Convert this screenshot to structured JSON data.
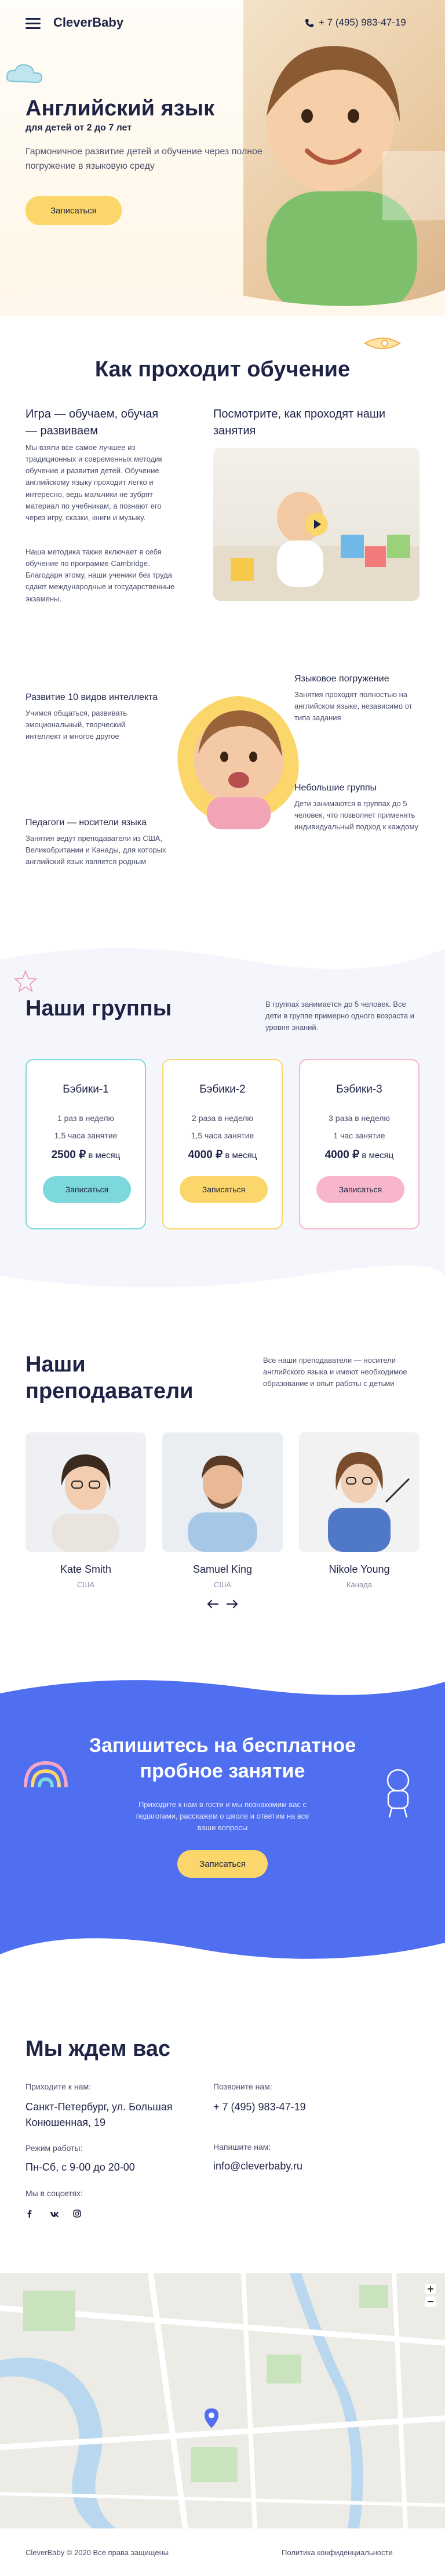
{
  "header": {
    "logo": "CleverBaby",
    "phone": "+ 7 (495) 983-47-19"
  },
  "hero": {
    "title": "Английский язык",
    "subtitle": "для детей от 2 до 7 лет",
    "text": "Гармоничное развитие детей и обучение через полное погружение в языковую среду",
    "cta": "Записаться"
  },
  "learning": {
    "title": "Как проходит обучение",
    "left_heading": "Игра — обучаем, обучая — развиваем",
    "left_p1": "Мы взяли все самое лучшее из традиционных и современных методик обучение и развития детей. Обучение английскому языку проходит легко и интересно, ведь мальчики не зубрят материал по учебникам, а познают его через игру, сказки, книги и музыку.",
    "left_p2": "Наша методика также включает в себя обучение по программе Cambridge. Благодаря этому, наши ученики без труда сдают международные и государственные экзамены.",
    "right_heading": "Посмотрите, как проходят наши занятия"
  },
  "features": [
    {
      "title": "Развитие 10 видов интеллекта",
      "text": "Учимся общаться, развивать эмоциональный, творческий интеллект и многое другое"
    },
    {
      "title": "Языковое погружение",
      "text": "Занятия проходят полностью на английском языке, независимо от типа задания"
    },
    {
      "title": "Небольшие группы",
      "text": "Дети занимаются в группах до 5 человек, что позволяет применять индивидуальный подход к каждому"
    },
    {
      "title": "Педагоги — носители языка",
      "text": "Занятия ведут преподаватели из США, Великобритании и Канады, для которых английский язык является родным"
    }
  ],
  "groups": {
    "title": "Наши группы",
    "note": "В группах занимается до 5 человек. Все дети в группе примерно одного возраста и уровня знаний.",
    "cards": [
      {
        "name": "Бэбики-1",
        "freq": "1 раз в неделю",
        "duration": "1,5 часа занятие",
        "price": "2500 ₽",
        "period": "в месяц",
        "button": "Записаться"
      },
      {
        "name": "Бэбики-2",
        "freq": "2 раза в неделю",
        "duration": "1,5 часа занятие",
        "price": "4000 ₽",
        "period": "в месяц",
        "button": "Записаться"
      },
      {
        "name": "Бэбики-3",
        "freq": "3 раза в неделю",
        "duration": "1 час занятие",
        "price": "4000 ₽",
        "period": "в месяц",
        "button": "Записаться"
      }
    ]
  },
  "teachers": {
    "title": "Наши преподаватели",
    "note": "Все наши преподаватели — носители английского языка и имеют необходимое образование и опыт работы с детьми",
    "people": [
      {
        "name": "Kate Smith",
        "country": "США"
      },
      {
        "name": "Samuel King",
        "country": "США"
      },
      {
        "name": "Nikole Young",
        "country": "Канада"
      }
    ]
  },
  "trial": {
    "title": "Запишитесь на бесплатное пробное занятие",
    "text": "Приходите к нам в гости и мы познакомим вас с педагогами, расскажем о школе и ответим на все ваши вопросы",
    "cta": "Записаться"
  },
  "contacts": {
    "title": "Мы ждем вас",
    "come_label": "Приходите к нам:",
    "address": "Санкт-Петербург, ул. Большая Конюшенная, 19",
    "hours_label": "Режим работы:",
    "hours": "Пн-Сб, с 9-00 до 20-00",
    "social_label": "Мы в соцсетях:",
    "call_label": "Позвоните нам:",
    "phone": "+ 7 (495) 983-47-19",
    "write_label": "Напишите нам:",
    "email": "info@cleverbaby.ru"
  },
  "footer": {
    "copyright": "CleverBaby © 2020 Все права защищены",
    "policy": "Политика конфиденциальности"
  },
  "colors": {
    "accent": "#4f6ef0",
    "yellow": "#fbd66a",
    "teal": "#7dd8dd",
    "pink": "#f7b6c9",
    "navy": "#1e2346"
  }
}
